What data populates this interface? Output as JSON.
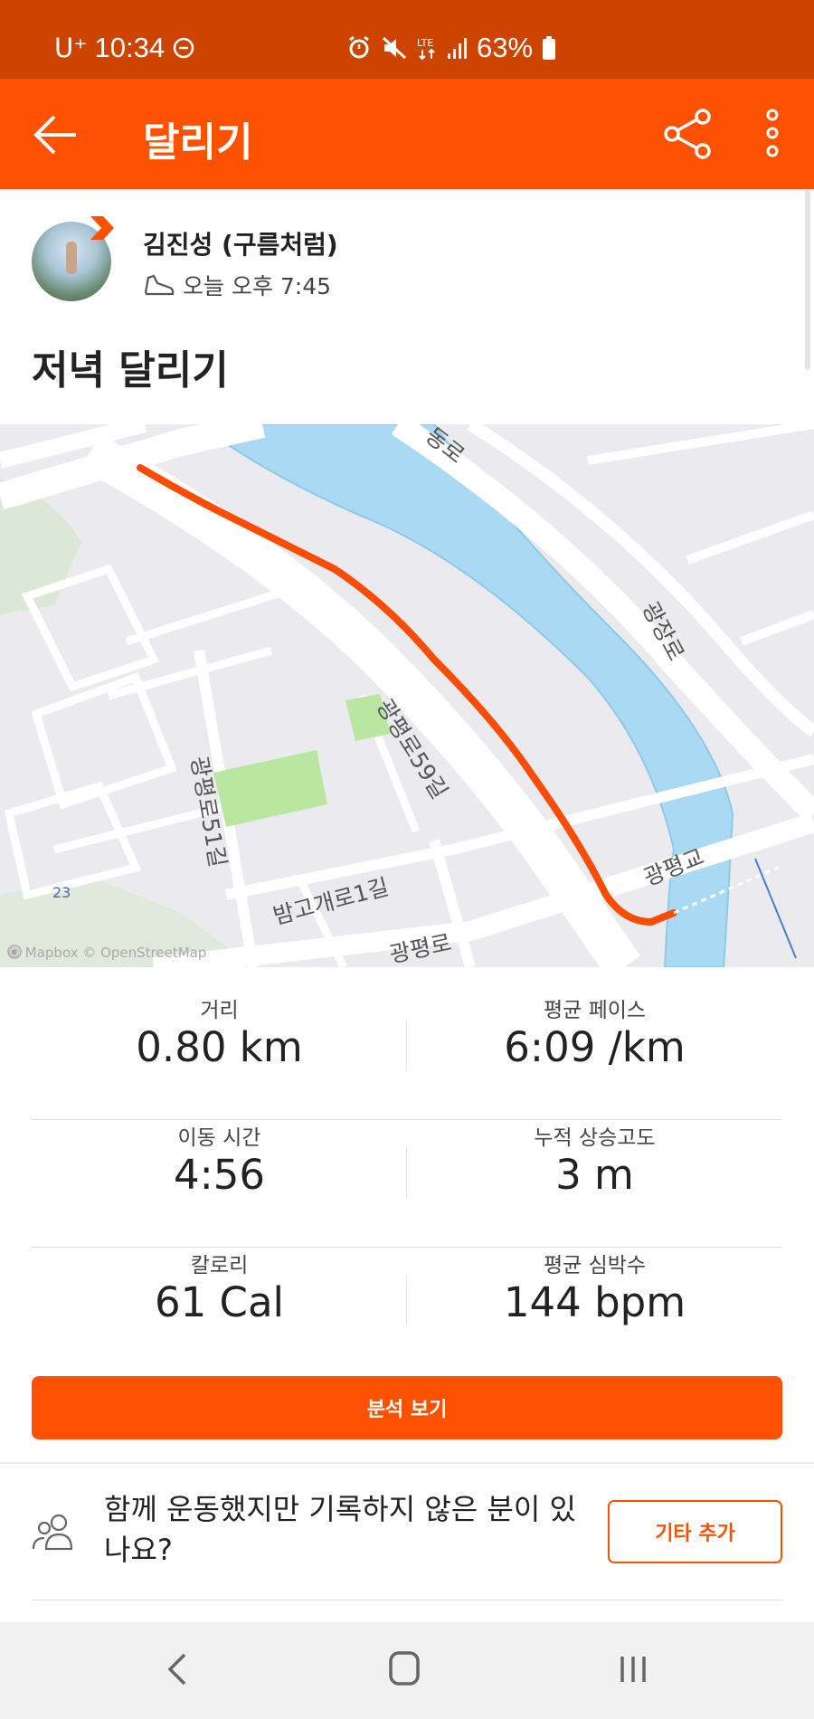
{
  "status_bar": {
    "carrier": "U⁺",
    "time": "10:34",
    "battery_pct": "63%"
  },
  "app_bar": {
    "title": "달리기",
    "back_icon": "arrow-left-icon",
    "share_icon": "share-icon",
    "more_icon": "more-vertical-icon"
  },
  "header": {
    "athlete_name": "김진성 (구름처럼)",
    "time_label": "오늘 오후 7:45",
    "activity_title": "저녁 달리기"
  },
  "map": {
    "labels": [
      "동로",
      "광장로",
      "광평로59길",
      "광평로51길",
      "밤고개로1길",
      "광평교",
      "광평로",
      "23"
    ],
    "attribution": "© Mapbox © OpenStreetMap",
    "route_color": "#fc4c02",
    "water_color": "#aadaf3",
    "park_color": "#b9e6a0"
  },
  "stats": {
    "distance": {
      "label": "거리",
      "value": "0.80 km"
    },
    "avg_pace": {
      "label": "평균 페이스",
      "value": "6:09 /km"
    },
    "moving_time": {
      "label": "이동 시간",
      "value": "4:56"
    },
    "elevation_gain": {
      "label": "누적 상승고도",
      "value": "3 m"
    },
    "calories": {
      "label": "칼로리",
      "value": "61 Cal"
    },
    "avg_hr": {
      "label": "평균 심박수",
      "value": "144 bpm"
    }
  },
  "actions": {
    "analysis_label": "분석 보기",
    "group_prompt": "함께 운동했지만 기록하지 않은 분이 있나요?",
    "add_others_label": "기타 추가"
  },
  "colors": {
    "accent": "#fc5200",
    "status_bar": "#cc4400"
  }
}
